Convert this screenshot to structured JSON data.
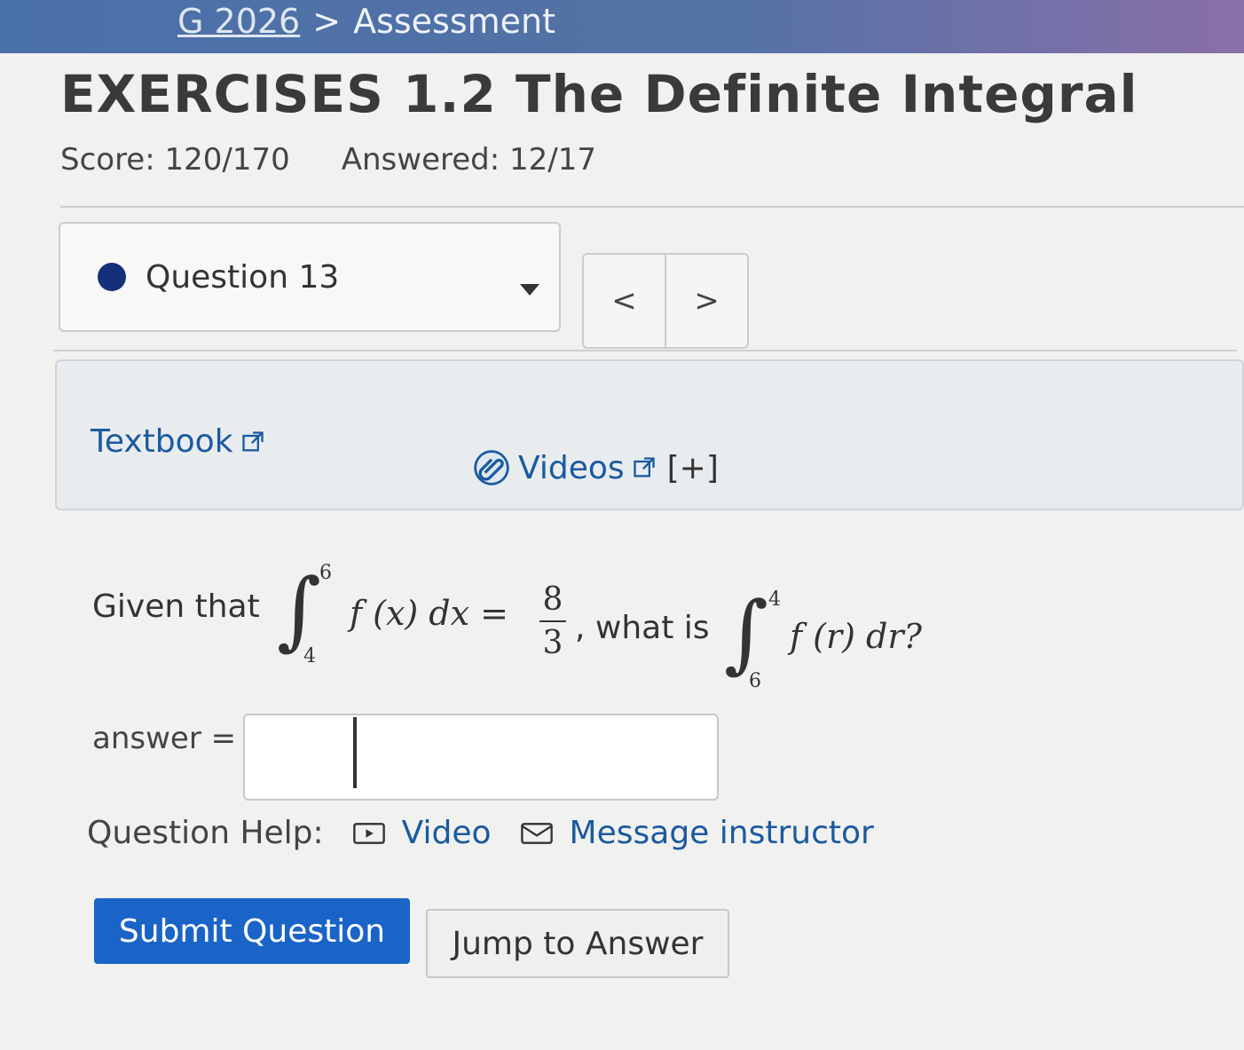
{
  "header": {
    "course_crumb": "G 2026",
    "separator": ">",
    "current_crumb": "Assessment"
  },
  "assignment": {
    "title": "EXERCISES 1.2 The Definite Integral",
    "score": "Score: 120/170",
    "answered": "Answered: 12/17"
  },
  "question_nav": {
    "selected": "Question 13",
    "prev": "<",
    "next": ">"
  },
  "resources": {
    "textbook": "Textbook",
    "videos": "Videos",
    "expand": "[+]"
  },
  "question": {
    "prefix": "Given that",
    "given_upper": "6",
    "given_lower": "4",
    "given_integrand": "f (x) dx =",
    "frac_num": "8",
    "frac_den": "3",
    "mid": ", what is",
    "ask_upper": "4",
    "ask_lower": "6",
    "ask_integrand": "f (r) dr?"
  },
  "answer": {
    "label": "answer =",
    "value": ""
  },
  "help": {
    "label": "Question Help:",
    "video": "Video",
    "message": "Message instructor"
  },
  "actions": {
    "submit": "Submit Question",
    "jump": "Jump to Answer"
  },
  "colors": {
    "accent": "#1a64c8",
    "link": "#1a5aa0",
    "status_dot": "#14307a"
  }
}
